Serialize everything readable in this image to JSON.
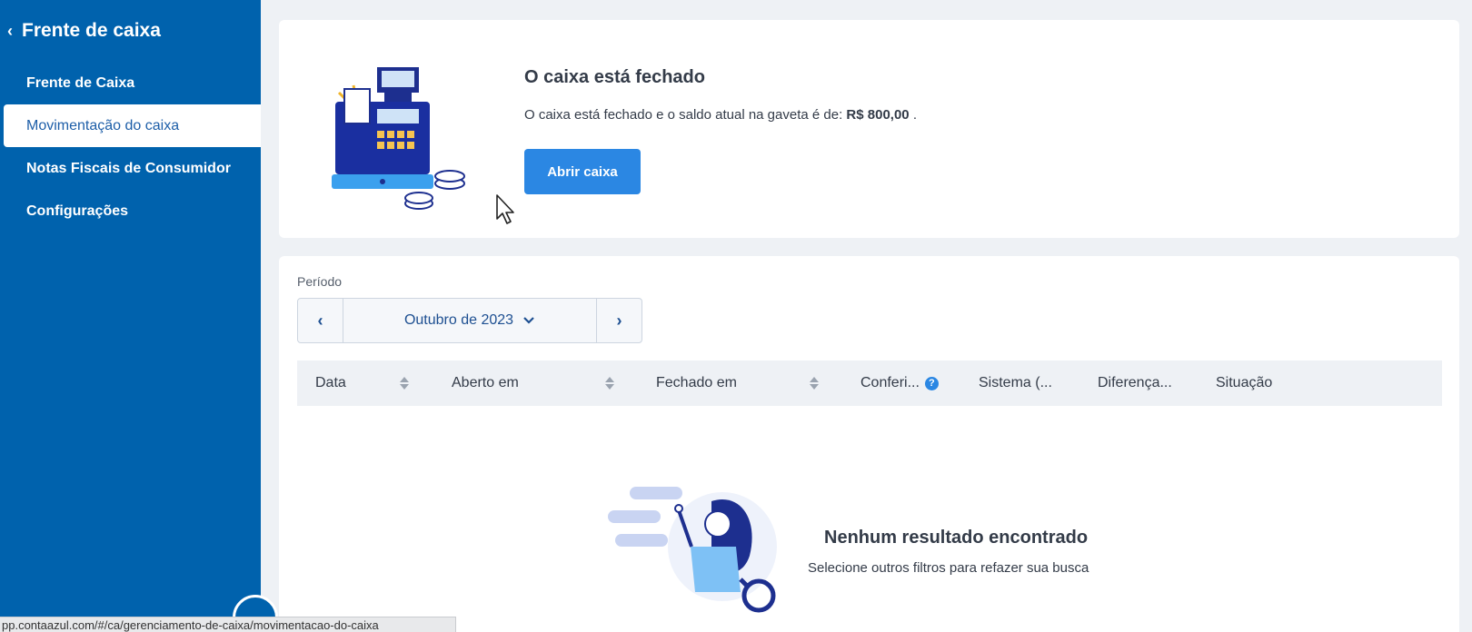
{
  "sidebar": {
    "header_title": "Frente de caixa",
    "items": [
      {
        "label": "Frente de Caixa",
        "active": false
      },
      {
        "label": "Movimentação do caixa",
        "active": true
      },
      {
        "label": "Notas Fiscais de Consumidor",
        "active": false
      },
      {
        "label": "Configurações",
        "active": false
      }
    ]
  },
  "status_card": {
    "title": "O caixa está fechado",
    "text_prefix": "O caixa está fechado e o saldo atual na gaveta é de: ",
    "balance": "R$ 800,00",
    "text_suffix": " .",
    "open_button": "Abrir caixa"
  },
  "filters": {
    "period_label": "Período",
    "month": "Outubro de 2023"
  },
  "table": {
    "columns": [
      {
        "label": "Data",
        "sortable": true
      },
      {
        "label": "Aberto em",
        "sortable": true
      },
      {
        "label": "Fechado em",
        "sortable": true
      },
      {
        "label": "Conferi...",
        "sortable": false,
        "help": true
      },
      {
        "label": "Sistema (...",
        "sortable": false
      },
      {
        "label": "Diferença...",
        "sortable": false
      },
      {
        "label": "Situação",
        "sortable": false
      }
    ]
  },
  "empty_state": {
    "title": "Nenhum resultado encontrado",
    "text": "Selecione outros filtros para refazer sua busca"
  },
  "browser_status": {
    "url": "pp.contaazul.com/#/ca/gerenciamento-de-caixa/movimentacao-do-caixa"
  },
  "colors": {
    "sidebar": "#0062ad",
    "primary_button": "#2b87e3",
    "accent_text": "#1d4f91"
  }
}
